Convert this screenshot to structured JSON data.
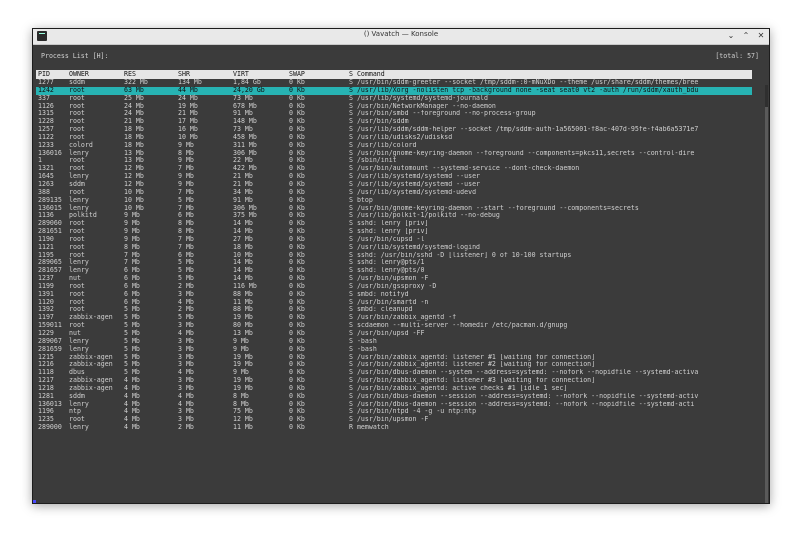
{
  "window": {
    "title": "() Vavatch — Konsole",
    "controls": {
      "minimize": "⌄",
      "maximize": "⌃",
      "close": "✕"
    }
  },
  "header": {
    "title": "Process List [H]:",
    "total": "[total: 57]"
  },
  "columns": [
    "PID",
    "OWNER",
    "RES",
    "SHR",
    "VIRT",
    "SWAP",
    "S Command"
  ],
  "selected_index": 1,
  "rows": [
    [
      "1277",
      "sddm",
      "322 Mb",
      "134 Mb",
      "1,84 Gb",
      "0 Kb",
      "S /usr/bin/sddm-greeter --socket /tmp/sddm-:0-mNuXDo --theme /usr/share/sddm/themes/bree"
    ],
    [
      "1242",
      "root",
      "63 Mb",
      "44 Mb",
      "24,20 Gb",
      "0 Kb",
      "S /usr/lib/Xorg -nolisten tcp -background none -seat seat0 vt2 -auth /run/sddm/xauth_bdu"
    ],
    [
      "337",
      "root",
      "25 Mb",
      "24 Mb",
      "73 Mb",
      "0 Kb",
      "S /usr/lib/systemd/systemd-journald"
    ],
    [
      "1126",
      "root",
      "24 Mb",
      "19 Mb",
      "678 Mb",
      "0 Kb",
      "S /usr/bin/NetworkManager --no-daemon"
    ],
    [
      "1315",
      "root",
      "24 Mb",
      "21 Mb",
      "91 Mb",
      "0 Kb",
      "S /usr/bin/smbd --foreground --no-process-group"
    ],
    [
      "1228",
      "root",
      "21 Mb",
      "17 Mb",
      "148 Mb",
      "0 Kb",
      "S /usr/bin/sddm"
    ],
    [
      "1257",
      "root",
      "18 Mb",
      "16 Mb",
      "73 Mb",
      "0 Kb",
      "S /usr/lib/sddm/sddm-helper --socket /tmp/sddm-auth-1a565001-f8ac-407d-95fe-f4ab6a5371e7"
    ],
    [
      "1122",
      "root",
      "18 Mb",
      "10 Mb",
      "458 Mb",
      "0 Kb",
      "S /usr/lib/udisks2/udisksd"
    ],
    [
      "1233",
      "colord",
      "18 Mb",
      "9 Mb",
      "311 Mb",
      "0 Kb",
      "S /usr/lib/colord"
    ],
    [
      "136016",
      "lenry",
      "13 Mb",
      "8 Mb",
      "306 Mb",
      "0 Kb",
      "S /usr/bin/gnome-keyring-daemon --foreground --components=pkcs11,secrets --control-dire"
    ],
    [
      "1",
      "root",
      "13 Mb",
      "9 Mb",
      "22 Mb",
      "0 Kb",
      "S /sbin/init"
    ],
    [
      "1321",
      "root",
      "12 Mb",
      "7 Mb",
      "422 Mb",
      "0 Kb",
      "S /usr/bin/automount --systemd-service --dont-check-daemon"
    ],
    [
      "1645",
      "lenry",
      "12 Mb",
      "9 Mb",
      "21 Mb",
      "0 Kb",
      "S /usr/lib/systemd/systemd --user"
    ],
    [
      "1263",
      "sddm",
      "12 Mb",
      "9 Mb",
      "21 Mb",
      "0 Kb",
      "S /usr/lib/systemd/systemd --user"
    ],
    [
      "388",
      "root",
      "10 Mb",
      "7 Mb",
      "34 Mb",
      "0 Kb",
      "S /usr/lib/systemd/systemd-udevd"
    ],
    [
      "289135",
      "lenry",
      "10 Mb",
      "5 Mb",
      "91 Mb",
      "0 Kb",
      "S btop"
    ],
    [
      "136015",
      "lenry",
      "10 Mb",
      "7 Mb",
      "306 Mb",
      "0 Kb",
      "S /usr/bin/gnome-keyring-daemon --start --foreground --components=secrets"
    ],
    [
      "1136",
      "polkitd",
      "9 Mb",
      "6 Mb",
      "375 Mb",
      "0 Kb",
      "S /usr/lib/polkit-1/polkitd --no-debug"
    ],
    [
      "289060",
      "root",
      "9 Mb",
      "8 Mb",
      "14 Mb",
      "0 Kb",
      "S sshd: lenry [priv]"
    ],
    [
      "281651",
      "root",
      "9 Mb",
      "8 Mb",
      "14 Mb",
      "0 Kb",
      "S sshd: lenry [priv]"
    ],
    [
      "1190",
      "root",
      "9 Mb",
      "7 Mb",
      "27 Mb",
      "0 Kb",
      "S /usr/bin/cupsd -l"
    ],
    [
      "1121",
      "root",
      "8 Mb",
      "7 Mb",
      "18 Mb",
      "0 Kb",
      "S /usr/lib/systemd/systemd-logind"
    ],
    [
      "1195",
      "root",
      "7 Mb",
      "6 Mb",
      "10 Mb",
      "0 Kb",
      "S sshd: /usr/bin/sshd -D [listener] 0 of 10-100 startups"
    ],
    [
      "289065",
      "lenry",
      "7 Mb",
      "5 Mb",
      "14 Mb",
      "0 Kb",
      "S sshd: lenry@pts/1"
    ],
    [
      "281657",
      "lenry",
      "6 Mb",
      "5 Mb",
      "14 Mb",
      "0 Kb",
      "S sshd: lenry@pts/0"
    ],
    [
      "1237",
      "nut",
      "6 Mb",
      "5 Mb",
      "14 Mb",
      "0 Kb",
      "S /usr/bin/upsmon -F"
    ],
    [
      "1199",
      "root",
      "6 Mb",
      "2 Mb",
      "116 Mb",
      "0 Kb",
      "S /usr/bin/gssproxy -D"
    ],
    [
      "1391",
      "root",
      "6 Mb",
      "3 Mb",
      "88 Mb",
      "0 Kb",
      "S smbd: notifyd"
    ],
    [
      "1120",
      "root",
      "6 Mb",
      "4 Mb",
      "11 Mb",
      "0 Kb",
      "S /usr/bin/smartd -n"
    ],
    [
      "1392",
      "root",
      "5 Mb",
      "2 Mb",
      "88 Mb",
      "0 Kb",
      "S smbd: cleanupd"
    ],
    [
      "1197",
      "zabbix-agen",
      "5 Mb",
      "5 Mb",
      "19 Mb",
      "0 Kb",
      "S /usr/bin/zabbix_agentd -f"
    ],
    [
      "159011",
      "root",
      "5 Mb",
      "3 Mb",
      "80 Mb",
      "0 Kb",
      "S scdaemon --multi-server --homedir /etc/pacman.d/gnupg"
    ],
    [
      "1229",
      "nut",
      "5 Mb",
      "4 Mb",
      "13 Mb",
      "0 Kb",
      "S /usr/bin/upsd -FF"
    ],
    [
      "289067",
      "lenry",
      "5 Mb",
      "3 Mb",
      "9 Mb",
      "0 Kb",
      "S -bash"
    ],
    [
      "281659",
      "lenry",
      "5 Mb",
      "3 Mb",
      "9 Mb",
      "0 Kb",
      "S -bash"
    ],
    [
      "1215",
      "zabbix-agen",
      "5 Mb",
      "3 Mb",
      "19 Mb",
      "0 Kb",
      "S /usr/bin/zabbix_agentd: listener #1 [waiting for connection]"
    ],
    [
      "1216",
      "zabbix-agen",
      "5 Mb",
      "3 Mb",
      "19 Mb",
      "0 Kb",
      "S /usr/bin/zabbix_agentd: listener #2 [waiting for connection]"
    ],
    [
      "1118",
      "dbus",
      "5 Mb",
      "4 Mb",
      "9 Mb",
      "0 Kb",
      "S /usr/bin/dbus-daemon --system --address=systemd: --nofork --nopidfile --systemd-activa"
    ],
    [
      "1217",
      "zabbix-agen",
      "4 Mb",
      "3 Mb",
      "19 Mb",
      "0 Kb",
      "S /usr/bin/zabbix_agentd: listener #3 [waiting for connection]"
    ],
    [
      "1218",
      "zabbix-agen",
      "4 Mb",
      "3 Mb",
      "19 Mb",
      "0 Kb",
      "S /usr/bin/zabbix_agentd: active checks #1 [idle 1 sec]"
    ],
    [
      "1281",
      "sddm",
      "4 Mb",
      "4 Mb",
      "8 Mb",
      "0 Kb",
      "S /usr/bin/dbus-daemon --session --address=systemd: --nofork --nopidfile --systemd-activ"
    ],
    [
      "136013",
      "lenry",
      "4 Mb",
      "4 Mb",
      "8 Mb",
      "0 Kb",
      "S /usr/bin/dbus-daemon --session --address=systemd: --nofork --nopidfile --systemd-acti"
    ],
    [
      "1196",
      "ntp",
      "4 Mb",
      "3 Mb",
      "75 Mb",
      "0 Kb",
      "S /usr/bin/ntpd -4 -g -u ntp:ntp"
    ],
    [
      "1235",
      "root",
      "4 Mb",
      "3 Mb",
      "12 Mb",
      "0 Kb",
      "S /usr/bin/upsmon -F"
    ],
    [
      "289000",
      "lenry",
      "4 Mb",
      "2 Mb",
      "11 Mb",
      "0 Kb",
      "R memwatch"
    ]
  ]
}
